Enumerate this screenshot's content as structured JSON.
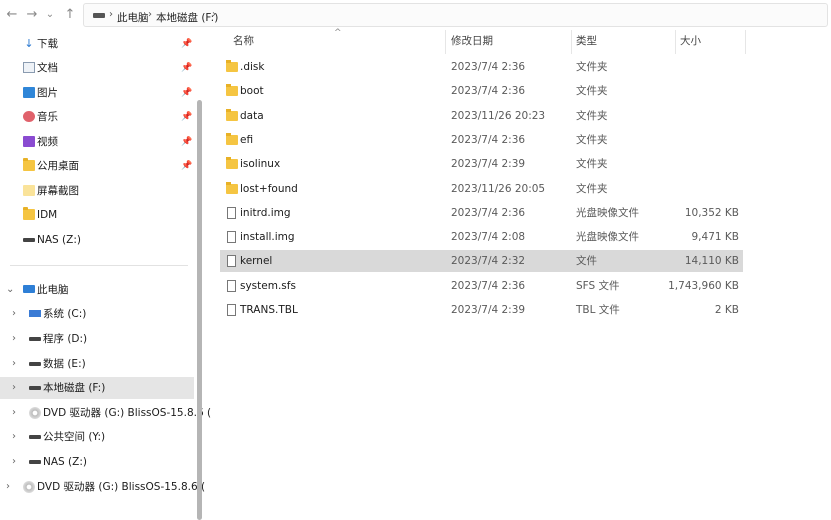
{
  "address": {
    "crumbs": [
      "此电脑",
      "本地磁盘 (F:)"
    ]
  },
  "sidebar": {
    "quick_access": [
      {
        "label": "下载",
        "icon": "download-icon"
      },
      {
        "label": "文档",
        "icon": "document-icon"
      },
      {
        "label": "图片",
        "icon": "pictures-icon"
      },
      {
        "label": "音乐",
        "icon": "music-icon"
      },
      {
        "label": "视频",
        "icon": "video-icon"
      },
      {
        "label": "公用桌面",
        "icon": "folder-icon"
      },
      {
        "label": "屏幕截图",
        "icon": "folder-icon"
      },
      {
        "label": "IDM",
        "icon": "folder-icon"
      },
      {
        "label": "NAS (Z:)",
        "icon": "network-drive-icon"
      }
    ],
    "this_pc": "此电脑",
    "drives": [
      {
        "label": "系统 (C:)"
      },
      {
        "label": "程序 (D:)"
      },
      {
        "label": "数据 (E:)"
      },
      {
        "label": "本地磁盘 (F:)"
      },
      {
        "label": "DVD 驱动器 (G:) BlissOS-15.8.6 ("
      },
      {
        "label": "公共空间 (Y:)"
      },
      {
        "label": "NAS (Z:)"
      }
    ],
    "dvd_root": "DVD 驱动器 (G:) BlissOS-15.8.6 ("
  },
  "columns": {
    "name": "名称",
    "date": "修改日期",
    "type": "类型",
    "size": "大小"
  },
  "files": [
    {
      "name": ".disk",
      "date": "2023/7/4 2:36",
      "type": "文件夹",
      "size": "",
      "kind": "folder"
    },
    {
      "name": "boot",
      "date": "2023/7/4 2:36",
      "type": "文件夹",
      "size": "",
      "kind": "folder"
    },
    {
      "name": "data",
      "date": "2023/11/26 20:23",
      "type": "文件夹",
      "size": "",
      "kind": "folder"
    },
    {
      "name": "efi",
      "date": "2023/7/4 2:36",
      "type": "文件夹",
      "size": "",
      "kind": "folder"
    },
    {
      "name": "isolinux",
      "date": "2023/7/4 2:39",
      "type": "文件夹",
      "size": "",
      "kind": "folder"
    },
    {
      "name": "lost+found",
      "date": "2023/11/26 20:05",
      "type": "文件夹",
      "size": "",
      "kind": "folder"
    },
    {
      "name": "initrd.img",
      "date": "2023/7/4 2:36",
      "type": "光盘映像文件",
      "size": "10,352 KB",
      "kind": "file"
    },
    {
      "name": "install.img",
      "date": "2023/7/4 2:08",
      "type": "光盘映像文件",
      "size": "9,471 KB",
      "kind": "file"
    },
    {
      "name": "kernel",
      "date": "2023/7/4 2:32",
      "type": "文件",
      "size": "14,110 KB",
      "kind": "file"
    },
    {
      "name": "system.sfs",
      "date": "2023/7/4 2:36",
      "type": "SFS 文件",
      "size": "1,743,960 KB",
      "kind": "file"
    },
    {
      "name": "TRANS.TBL",
      "date": "2023/7/4 2:39",
      "type": "TBL 文件",
      "size": "2 KB",
      "kind": "file"
    }
  ]
}
